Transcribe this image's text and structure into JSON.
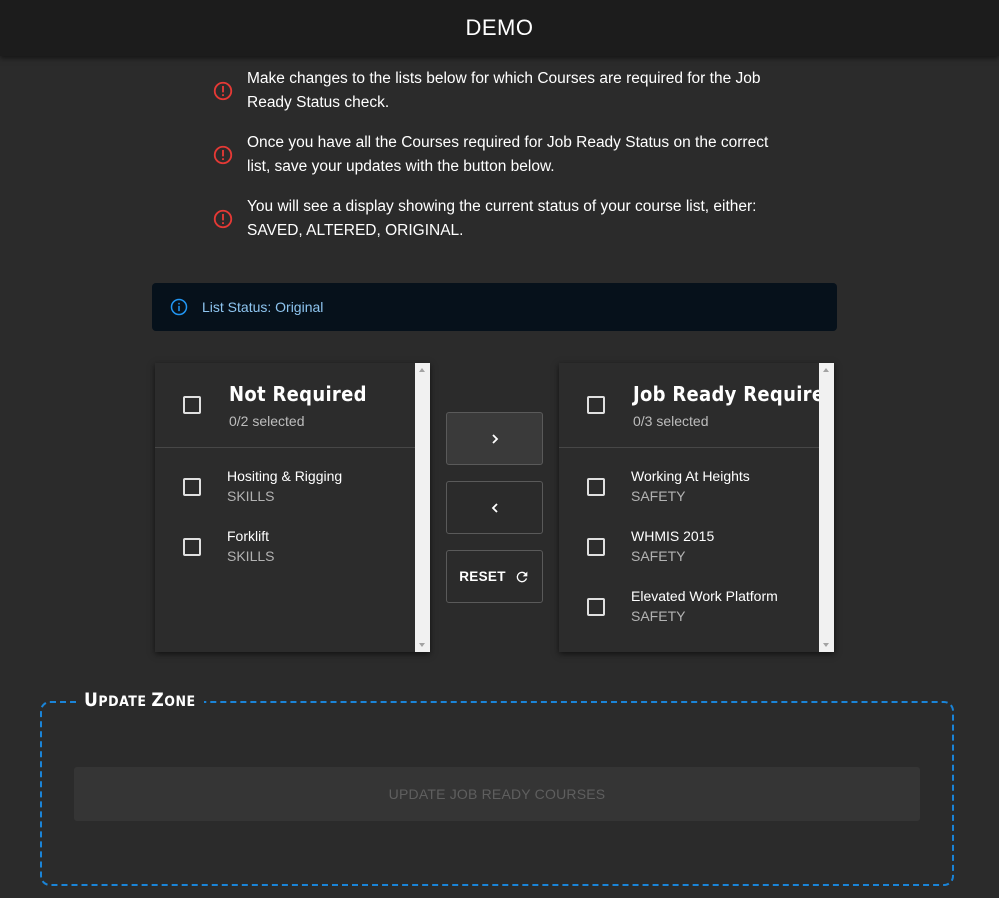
{
  "app": {
    "title": "DEMO"
  },
  "instructions": [
    "Make changes to the lists below for which Courses are required for the Job Ready Status check.",
    "Once you have all the Courses required for Job Ready Status on the correct list, save your updates with the button below.",
    "You will see a display showing the current status of your course list, either: SAVED, ALTERED, ORIGINAL."
  ],
  "status_alert": {
    "text": "List Status: Original"
  },
  "left_list": {
    "title": "Not Required",
    "selected": "0/2 selected",
    "items": [
      {
        "name": "Hositing & Rigging",
        "category": "SKILLS"
      },
      {
        "name": "Forklift",
        "category": "SKILLS"
      }
    ]
  },
  "right_list": {
    "title": "Job Ready Required",
    "selected": "0/3 selected",
    "items": [
      {
        "name": "Working At Heights",
        "category": "SAFETY"
      },
      {
        "name": "WHMIS 2015",
        "category": "SAFETY"
      },
      {
        "name": "Elevated Work Platform",
        "category": "SAFETY"
      }
    ]
  },
  "controls": {
    "move_right_icon": "chevron-right-icon",
    "move_left_icon": "chevron-left-icon",
    "reset_label": "RESET",
    "reset_icon": "refresh-icon"
  },
  "update_zone": {
    "legend_first": "U",
    "legend_rest": "PDATE ",
    "legend_first2": "Z",
    "legend_rest2": "ONE",
    "button_label": "UPDATE JOB READY COURSES"
  },
  "colors": {
    "warning": "#e53935",
    "info": "#2196f3",
    "zone_border": "#1a84d8",
    "background": "#2b2b2b",
    "appbar": "#1c1c1c"
  }
}
